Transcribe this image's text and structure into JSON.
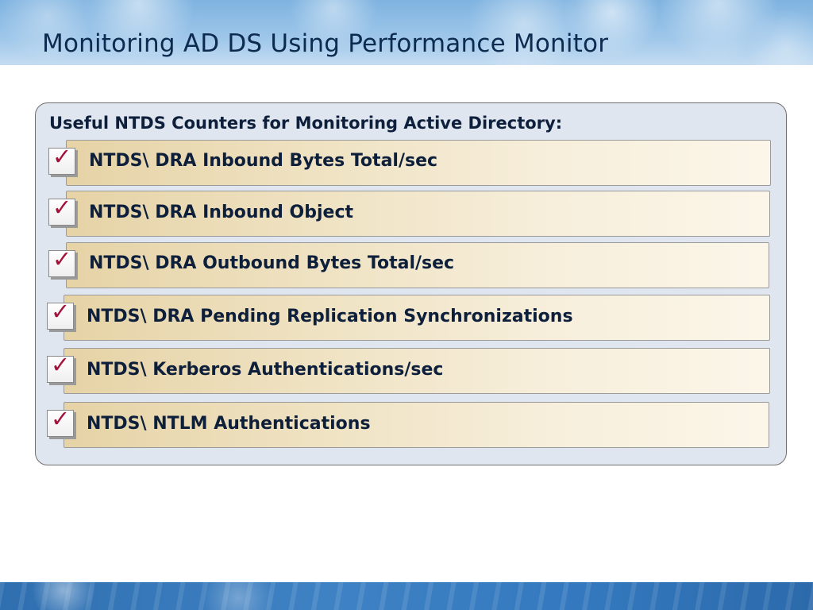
{
  "slide": {
    "title": "Monitoring AD DS Using Performance Monitor"
  },
  "panel": {
    "heading": "Useful NTDS Counters for Monitoring Active Directory:",
    "items": [
      {
        "label": "NTDS\\ DRA Inbound Bytes Total/sec",
        "checked": true
      },
      {
        "label": "NTDS\\ DRA Inbound Object",
        "checked": true
      },
      {
        "label": "NTDS\\ DRA Outbound Bytes Total/sec",
        "checked": true
      },
      {
        "label": "NTDS\\ DRA Pending Replication Synchronizations",
        "checked": true
      },
      {
        "label": "NTDS\\ Kerberos Authentications/sec",
        "checked": true
      },
      {
        "label": "NTDS\\ NTLM Authentications",
        "checked": true
      }
    ]
  },
  "icons": {
    "check": "check-mark-icon",
    "check_symbol": "✓",
    "check_color": "#a3123a"
  },
  "colors": {
    "header_blue": "#7fb3e0",
    "footer_blue": "#3479bf",
    "panel_bg": "#dfe6ef",
    "item_gold": "#e6d3a6",
    "title_text": "#0d2a4f"
  }
}
